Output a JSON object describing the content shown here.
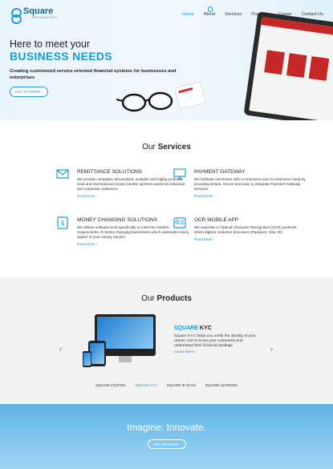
{
  "brand": {
    "name": "Square",
    "tagline": "TECHNOLOGY"
  },
  "nav": [
    "Home",
    "About",
    "Services",
    "Products",
    "Career",
    "Contact Us"
  ],
  "hero": {
    "line1": "Here to meet your",
    "line2": "BUSINESS NEEDS",
    "description": "Creating customized service oriented financial systems for businesses and enterprises",
    "cta": "GET STARTED ›"
  },
  "services": {
    "title_prefix": "Our",
    "title_bold": "Services",
    "items": [
      {
        "title": "REMITTANCE SOLUTIONS",
        "text": "We provide compliant, streamlined, scalable and highly profitable local and international money transfer systems aimed at individual and corporate customers.",
        "more": "Read More ›",
        "icon": "envelope-icon"
      },
      {
        "title": "PAYMENT GATEWAY",
        "text": "We facilitate merchants with e-commerce and m-commerce need by providing simple, secure and easy to integrate Payment Gateway services.",
        "more": "Read More ›",
        "icon": "monitor-icon"
      },
      {
        "title": "MONEY CHANGING SOLUTIONS",
        "text": "We deliver software built specifically to meet the modern requirements of money changing businesses which automates every aspect of your money service.",
        "more": "Read More ›",
        "icon": "currency-exchange-icon"
      },
      {
        "title": "OCR MOBILE APP",
        "text": "We expertise in Optical Character Recognition (OCR) products which digitize customer document (Passport, Visa, ID)",
        "more": "Read More ›",
        "icon": "id-card-icon"
      }
    ]
  },
  "products": {
    "title_prefix": "Our",
    "title_bold": "Products",
    "featured": {
      "brand": "SQUARE",
      "name": "KYC",
      "description": "Square KYC helps you verify the identity of your clients. Get to know your customers and understand their financial dealings.",
      "more": "Learn More ›"
    },
    "tabs": [
      "SQUARE COUPON",
      "SQUARE KYC",
      "SQUARE ID SCAN",
      "SQUARE LEARNING"
    ],
    "active_tab": "SQUARE KYC",
    "prev": "‹",
    "next": "›"
  },
  "cta": {
    "title": "Imagine. Innovate.",
    "button": "GET STARTED ›"
  },
  "colors": {
    "accent": "#1d9ad6",
    "cta_gradient_top": "#5fb5e6",
    "card_red": "#c62828"
  }
}
